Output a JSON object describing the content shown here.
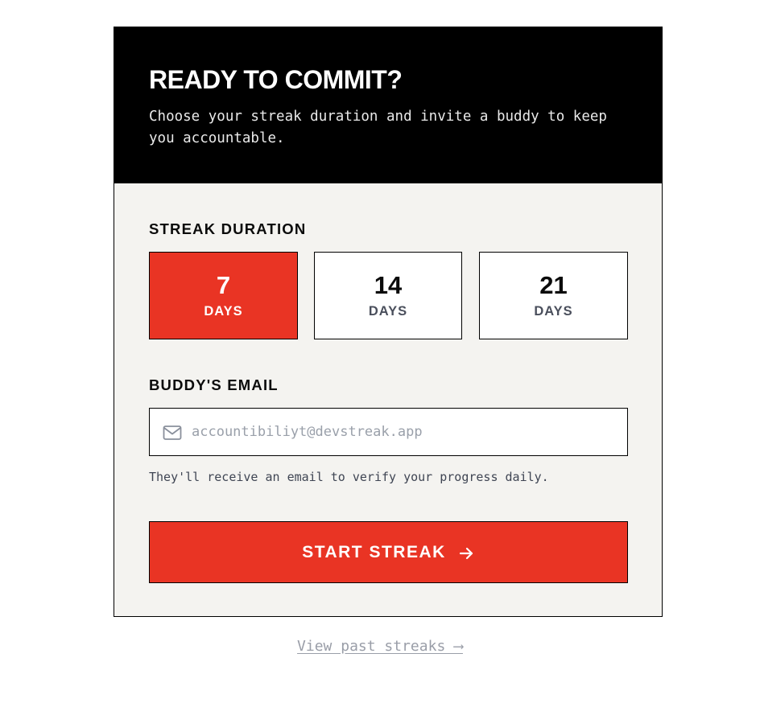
{
  "header": {
    "title": "READY TO COMMIT?",
    "subtitle": "Choose your streak duration and invite a buddy to keep you accountable."
  },
  "duration": {
    "label": "STREAK DURATION",
    "options": [
      {
        "value": "7",
        "unit": "DAYS",
        "selected": true
      },
      {
        "value": "14",
        "unit": "DAYS",
        "selected": false
      },
      {
        "value": "21",
        "unit": "DAYS",
        "selected": false
      }
    ]
  },
  "email": {
    "label": "BUDDY'S EMAIL",
    "placeholder": "accountibiliyt@devstreak.app",
    "value": "",
    "icon": "mail-icon",
    "helper": "They'll receive an email to verify your progress daily."
  },
  "start_button": {
    "label": "START STREAK",
    "icon": "arrow-right-icon"
  },
  "footer": {
    "link": "View past streaks ⟶"
  },
  "colors": {
    "accent": "#e93424",
    "header_bg": "#000000",
    "card_bg": "#f4f3f0"
  }
}
